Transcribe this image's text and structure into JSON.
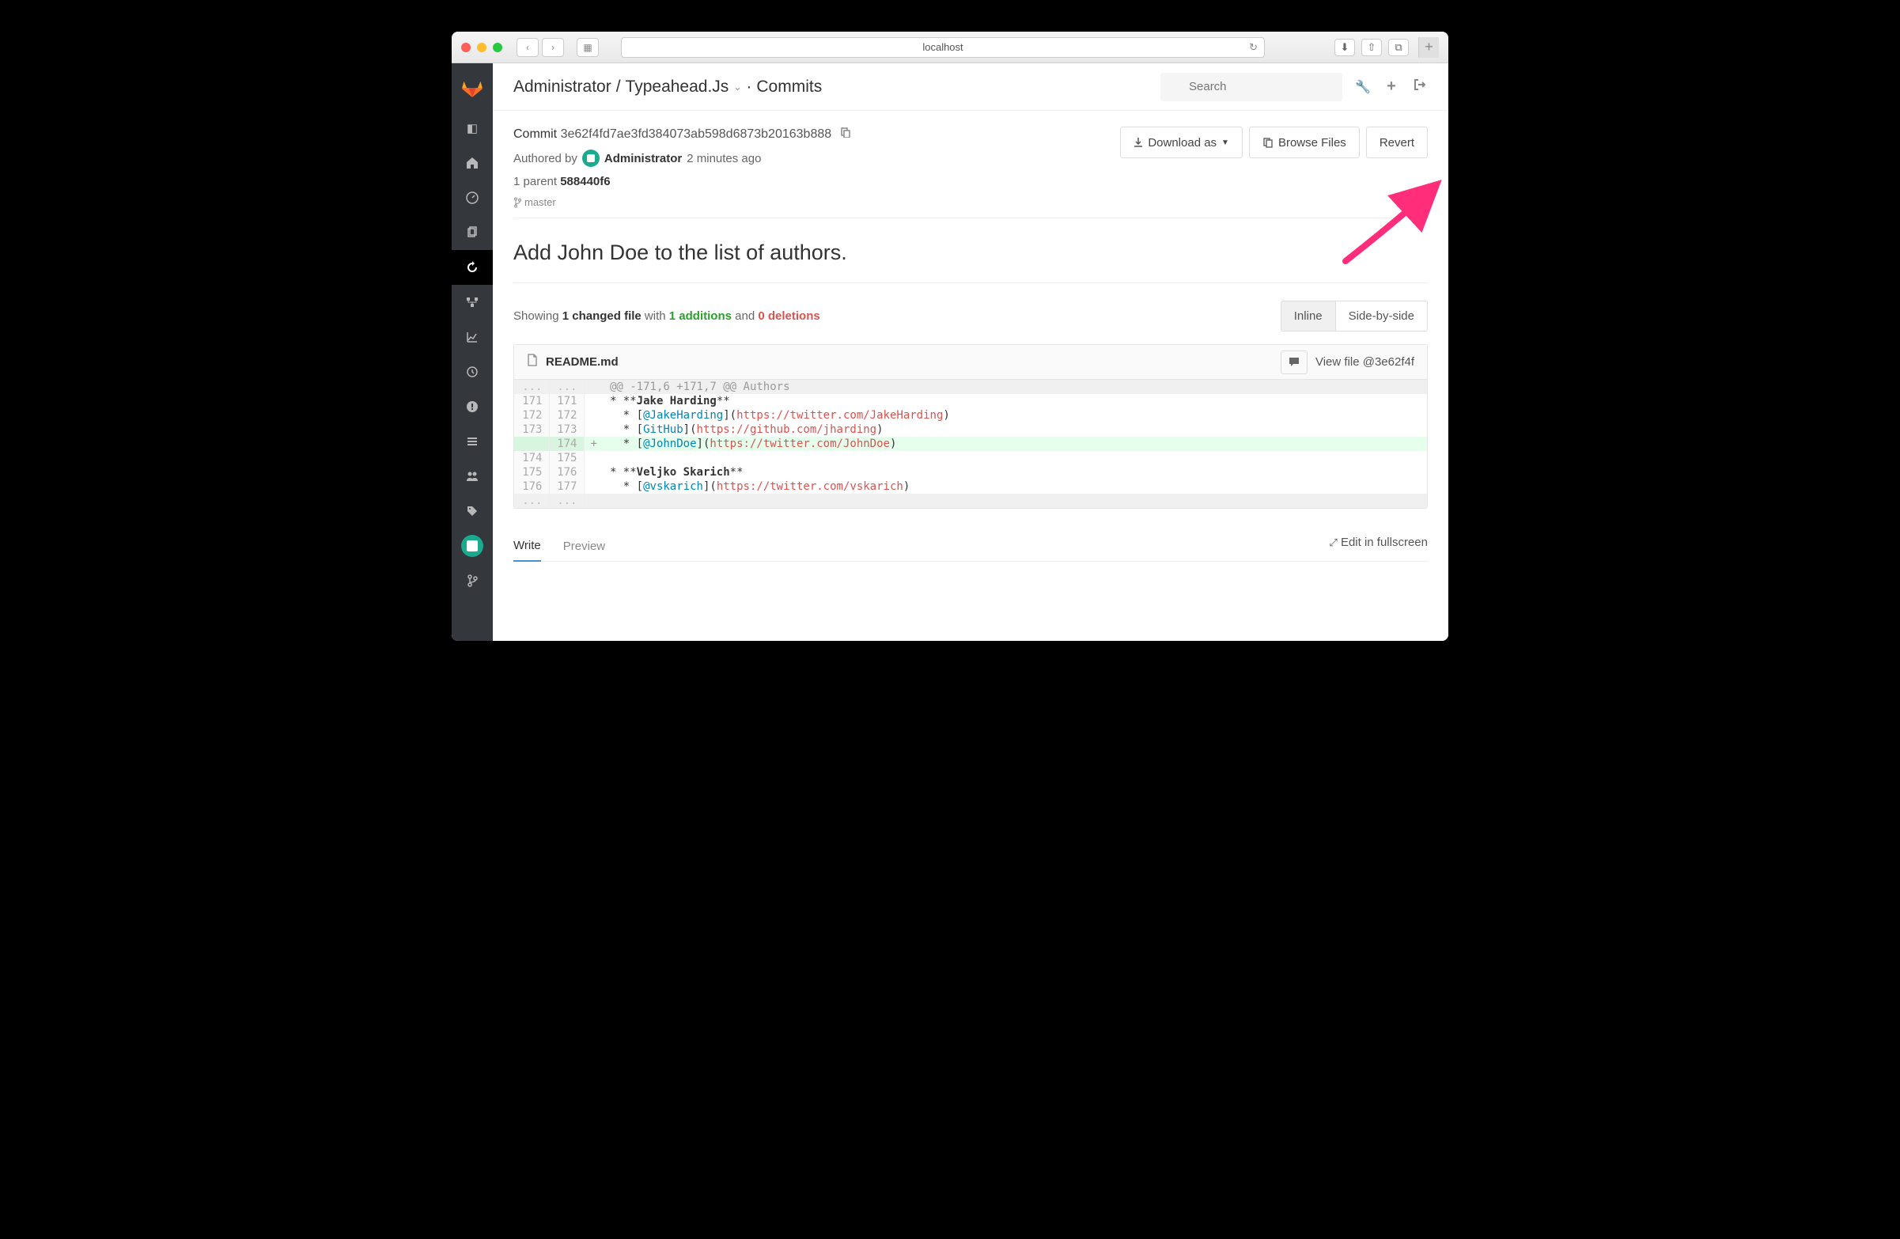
{
  "browser": {
    "address": "localhost"
  },
  "breadcrumb": {
    "owner": "Administrator",
    "project": "Typeahead.Js",
    "section": "Commits"
  },
  "search": {
    "placeholder": "Search"
  },
  "commit": {
    "label": "Commit",
    "hash": "3e62f4fd7ae3fd384073ab598d6873b20163b888",
    "authored_by": "Authored by",
    "author": "Administrator",
    "time_ago": "2 minutes ago",
    "parent_label": "1 parent",
    "parent_hash": "588440f6",
    "branch": "master",
    "title": "Add John Doe to the list of authors."
  },
  "actions": {
    "download": "Download as",
    "browse": "Browse Files",
    "revert": "Revert"
  },
  "changes": {
    "showing": "Showing",
    "file_count": "1 changed file",
    "with": "with",
    "additions": "1 additions",
    "and": "and",
    "deletions": "0 deletions"
  },
  "view_modes": {
    "inline": "Inline",
    "sbs": "Side-by-side"
  },
  "diff": {
    "filename": "README.md",
    "view_file": "View file @3e62f4f",
    "hunk": "@@ -171,6 +171,7 @@ Authors",
    "lines": [
      {
        "o": "171",
        "n": "171",
        "sign": " ",
        "html": "* **<span class='md-strong'>Jake Harding</span>**"
      },
      {
        "o": "172",
        "n": "172",
        "sign": " ",
        "html": "  * [<span class='md-linktext'>@JakeHarding</span>](<span class='md-link'>https://twitter.com/JakeHarding</span>)"
      },
      {
        "o": "173",
        "n": "173",
        "sign": " ",
        "html": "  * [<span class='md-linktext'>GitHub</span>](<span class='md-link'>https://github.com/jharding</span>)"
      },
      {
        "o": "",
        "n": "174",
        "sign": "+",
        "html": "  * [<span class='md-linktext'>@JohnDoe</span>](<span class='md-link'>https://twitter.com/JohnDoe</span>)",
        "add": true
      },
      {
        "o": "174",
        "n": "175",
        "sign": " ",
        "html": ""
      },
      {
        "o": "175",
        "n": "176",
        "sign": " ",
        "html": "* **<span class='md-strong'>Veljko Skarich</span>**"
      },
      {
        "o": "176",
        "n": "177",
        "sign": " ",
        "html": "  * [<span class='md-linktext'>@vskarich</span>](<span class='md-link'>https://twitter.com/vskarich</span>)"
      }
    ]
  },
  "editor": {
    "write": "Write",
    "preview": "Preview",
    "fullscreen": "Edit in fullscreen"
  }
}
